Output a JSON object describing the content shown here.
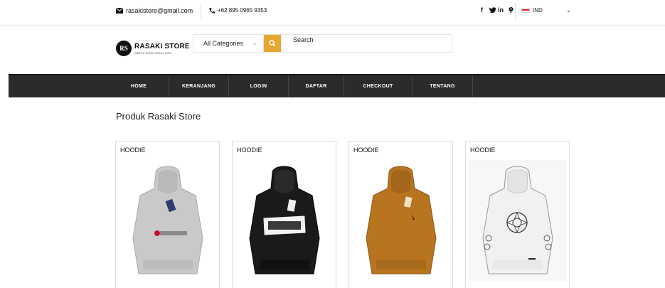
{
  "topbar": {
    "email": "rasakistore@gmail.com",
    "phone": "+62 895 0965 9353",
    "social": [
      "f",
      "tw",
      "in",
      "p"
    ],
    "language": "IND"
  },
  "header": {
    "logo_badge": "RS",
    "logo_name": "RASAKI STORE",
    "logo_tag": "SIMPLE IDEAL GREAT IDEA",
    "category_select": "All Categories",
    "search_value": "Search"
  },
  "nav": {
    "items": [
      {
        "label": "HOME"
      },
      {
        "label": "KERANJANG"
      },
      {
        "label": "LOGIN"
      },
      {
        "label": "DAFTAR"
      },
      {
        "label": "CHECKOUT"
      },
      {
        "label": "TENTANG"
      }
    ]
  },
  "main": {
    "title": "Produk Rasaki Store",
    "products": [
      {
        "category": "HOODIE",
        "color": "#c9c9c9",
        "variant": "champion"
      },
      {
        "category": "HOODIE",
        "color": "#1a1a1a",
        "variant": "print"
      },
      {
        "category": "HOODIE",
        "color": "#b8741f",
        "variant": "plain"
      },
      {
        "category": "HOODIE",
        "color": "#f1f1f1",
        "variant": "mandala"
      }
    ]
  },
  "colors": {
    "nav_bg": "#2b2b2b",
    "accent": "#e7a531"
  }
}
